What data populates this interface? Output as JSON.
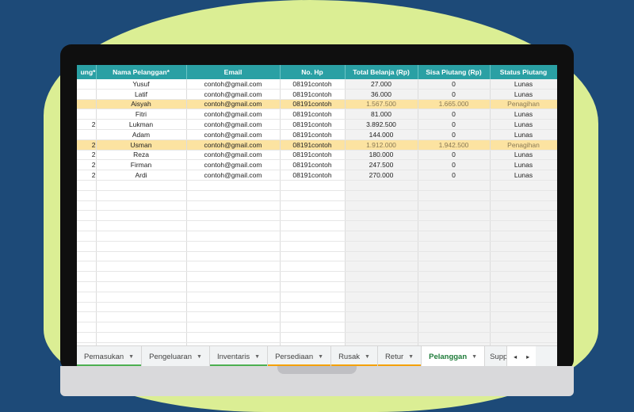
{
  "colors": {
    "background": "#1d4a78",
    "blob": "#dbee94",
    "header": "#2aa0a4",
    "highlight": "#fce3a1",
    "calc_cell": "#f2f2f2",
    "active_tab_text": "#1e7b39"
  },
  "sheet": {
    "headers": [
      "ung*",
      "Nama Pelanggan*",
      "Email",
      "No. Hp",
      "Total Belanja (Rp)",
      "Sisa Piutang (Rp)",
      "Status Piutang"
    ],
    "rows": [
      {
        "a": "",
        "nama": "Yusuf",
        "email": "contoh@gmail.com",
        "hp": "08191contoh",
        "total": "27.000",
        "sisa": "0",
        "status": "Lunas",
        "highlight": false
      },
      {
        "a": "",
        "nama": "Latif",
        "email": "contoh@gmail.com",
        "hp": "08191contoh",
        "total": "36.000",
        "sisa": "0",
        "status": "Lunas",
        "highlight": false
      },
      {
        "a": "",
        "nama": "Aisyah",
        "email": "contoh@gmail.com",
        "hp": "08191contoh",
        "total": "1.567.500",
        "sisa": "1.665.000",
        "status": "Penagihan",
        "highlight": true
      },
      {
        "a": "",
        "nama": "Fitri",
        "email": "contoh@gmail.com",
        "hp": "08191contoh",
        "total": "81.000",
        "sisa": "0",
        "status": "Lunas",
        "highlight": false
      },
      {
        "a": "2",
        "nama": "Lukman",
        "email": "contoh@gmail.com",
        "hp": "08191contoh",
        "total": "3.892.500",
        "sisa": "0",
        "status": "Lunas",
        "highlight": false
      },
      {
        "a": "",
        "nama": "Adam",
        "email": "contoh@gmail.com",
        "hp": "08191contoh",
        "total": "144.000",
        "sisa": "0",
        "status": "Lunas",
        "highlight": false
      },
      {
        "a": "2",
        "nama": "Usman",
        "email": "contoh@gmail.com",
        "hp": "08191contoh",
        "total": "1.912.000",
        "sisa": "1.942.500",
        "status": "Penagihan",
        "highlight": true
      },
      {
        "a": "2",
        "nama": "Reza",
        "email": "contoh@gmail.com",
        "hp": "08191contoh",
        "total": "180.000",
        "sisa": "0",
        "status": "Lunas",
        "highlight": false
      },
      {
        "a": "2",
        "nama": "Firman",
        "email": "contoh@gmail.com",
        "hp": "08191contoh",
        "total": "247.500",
        "sisa": "0",
        "status": "Lunas",
        "highlight": false
      },
      {
        "a": "2",
        "nama": "Ardi",
        "email": "contoh@gmail.com",
        "hp": "08191contoh",
        "total": "270.000",
        "sisa": "0",
        "status": "Lunas",
        "highlight": false
      }
    ]
  },
  "tabs": [
    {
      "label": "Pemasukan",
      "underline": "#4caf50",
      "active": false
    },
    {
      "label": "Pengeluaran",
      "underline": "",
      "active": false
    },
    {
      "label": "Inventaris",
      "underline": "#4caf50",
      "active": false
    },
    {
      "label": "Persediaan",
      "underline": "#f4a000",
      "active": false
    },
    {
      "label": "Rusak",
      "underline": "#f4a000",
      "active": false
    },
    {
      "label": "Retur",
      "underline": "#f4a000",
      "active": false
    },
    {
      "label": "Pelanggan",
      "underline": "#ffffff",
      "active": true
    },
    {
      "label": "Supp",
      "underline": "",
      "active": false,
      "partial": true
    }
  ],
  "nav": {
    "prev_icon": "chevron-left-icon",
    "next_icon": "chevron-right-icon",
    "prev": "◂",
    "next": "▸"
  }
}
